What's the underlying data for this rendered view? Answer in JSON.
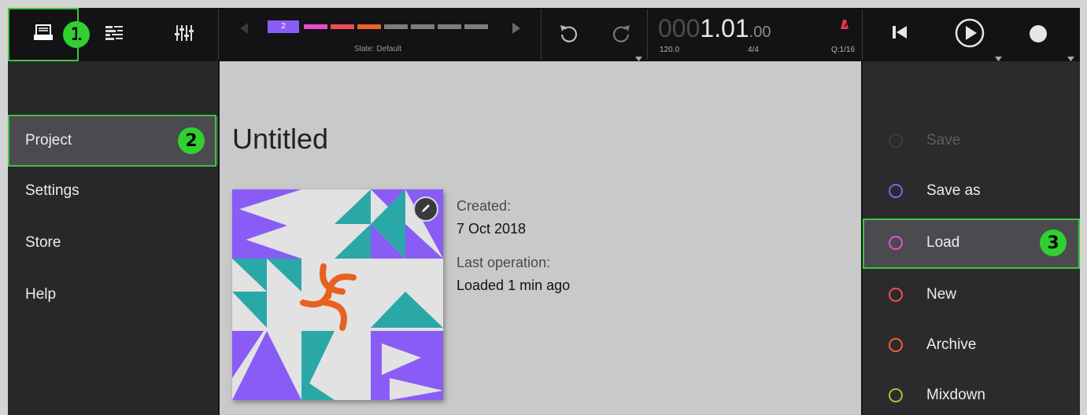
{
  "toolbar": {
    "views": [
      {
        "name": "browser",
        "icon": "project-browser-icon"
      },
      {
        "name": "arrange",
        "icon": "arrange-list-icon"
      },
      {
        "name": "mixer",
        "icon": "mixer-faders-icon"
      }
    ],
    "slate": {
      "active_number": "2",
      "label": "Slate: Default",
      "segments": [
        "#e64fcb",
        "#f14b5a",
        "#f0602a",
        "#7d7d80",
        "#7d7d80",
        "#7d7d80",
        "#7d7d80"
      ],
      "active_color": "#8a5cf6"
    },
    "undo_icon": "undo-icon",
    "redo_icon": "redo-icon",
    "position": {
      "dim": "000",
      "main": "1.01",
      "sub": ".00"
    },
    "tempo": "120.0",
    "signature": "4/4",
    "quantize": "Q:1/16",
    "metronome_color": "#e8334a",
    "transport": [
      "skip-to-start-icon",
      "play-icon",
      "record-icon"
    ]
  },
  "badges": {
    "one": "1",
    "two": "2",
    "three": "3"
  },
  "sidebar": {
    "items": [
      {
        "label": "Project",
        "active": true
      },
      {
        "label": "Settings",
        "active": false
      },
      {
        "label": "Store",
        "active": false
      },
      {
        "label": "Help",
        "active": false
      }
    ]
  },
  "project": {
    "title": "Untitled",
    "created_label": "Created:",
    "created_value": "7 Oct 2018",
    "last_op_label": "Last operation:",
    "last_op_value": "Loaded 1 min ago"
  },
  "actions": {
    "items": [
      {
        "label": "Save",
        "color": "#3c3c3f",
        "disabled": true
      },
      {
        "label": "Save as",
        "color": "#8a5cf6",
        "disabled": false
      },
      {
        "label": "Load",
        "color": "#e64fcb",
        "disabled": false,
        "active": true
      },
      {
        "label": "New",
        "color": "#f14b5a",
        "disabled": false
      },
      {
        "label": "Archive",
        "color": "#f0602a",
        "disabled": false
      },
      {
        "label": "Mixdown",
        "color": "#a3c43b",
        "disabled": false
      }
    ]
  },
  "colors": {
    "accent_green": "#2fd02f",
    "purple": "#8a5cf6",
    "teal": "#2aa8a8",
    "orange": "#e8611e"
  }
}
